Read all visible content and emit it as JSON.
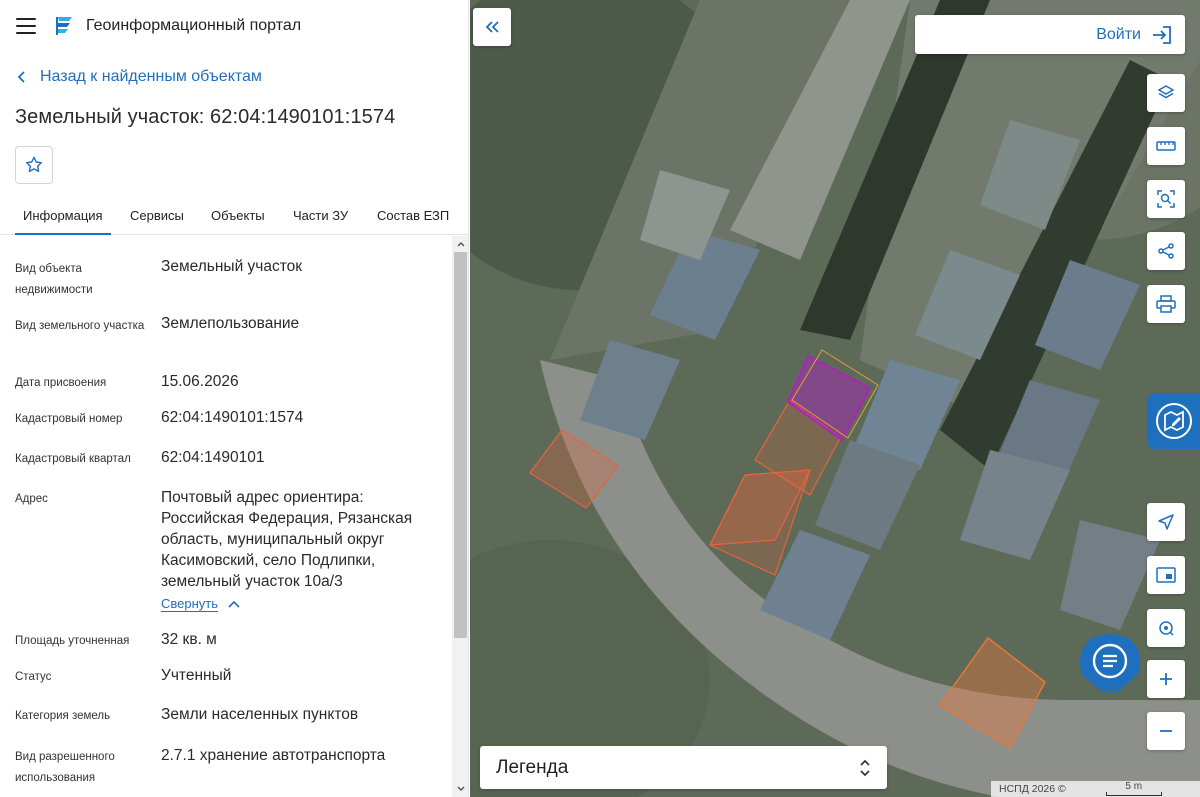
{
  "header": {
    "title": "Геоинформационный портал",
    "menu_icon": "burger-menu-icon",
    "logo_icon": "portal-logo-icon"
  },
  "back_link": "Назад к найденным объектам",
  "page_title": "Земельный участок: 62:04:1490101:1574",
  "tabs": [
    {
      "label": "Информация",
      "active": true
    },
    {
      "label": "Сервисы"
    },
    {
      "label": "Объекты"
    },
    {
      "label": "Части ЗУ"
    },
    {
      "label": "Состав ЕЗП"
    }
  ],
  "info": [
    {
      "label": "Вид объекта недвижимости",
      "value": "Земельный участок"
    },
    {
      "label": "Вид земельного участка",
      "value": "Землепользование"
    },
    {
      "label": "Дата присвоения",
      "value": "15.06.2026"
    },
    {
      "label": "Кадастровый номер",
      "value": "62:04:1490101:1574"
    },
    {
      "label": "Кадастровый квартал",
      "value": "62:04:1490101"
    },
    {
      "label": "Адрес",
      "value": "Почтовый адрес ориентира: Российская Федерация, Рязанская область, муниципальный округ Касимовский, село Подлипки, земельный участок 10а/3"
    },
    {
      "label": "Площадь уточненная",
      "value": "32 кв. м"
    },
    {
      "label": "Статус",
      "value": "Учтенный"
    },
    {
      "label": "Категория земель",
      "value": "Земли населенных пунктов"
    },
    {
      "label": "Вид разрешенного использования",
      "value": "2.7.1 хранение автотранспорта"
    }
  ],
  "collapse_label": "Свернуть",
  "map": {
    "login_label": "Войти",
    "legend_label": "Легенда",
    "attribution": "НСПД 2026 ©",
    "scale_label": "5 m",
    "accent_color": "#1f6fbf",
    "selected_parcel_color": "#b020c0",
    "parcel_color": "#e8633a"
  }
}
